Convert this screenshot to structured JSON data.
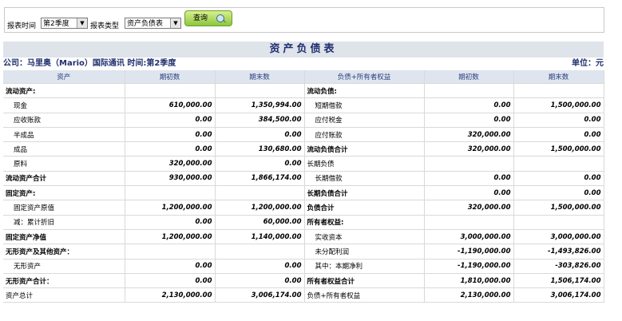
{
  "toolbar": {
    "period_label": "报表时间",
    "period_value": "第2季度",
    "type_label": "报表类型",
    "type_value": "资产负债表",
    "query_label": "查询"
  },
  "report": {
    "title": "资产负债表",
    "company_line": "公司：马里奥（Mario）国际通讯 时间:第2季度",
    "unit": "单位：元",
    "headers": [
      "资产",
      "期初数",
      "期末数",
      "负债+所有者权益",
      "期初数",
      "期末数"
    ],
    "rows": [
      [
        "流动资产:",
        "",
        "",
        "流动负债:",
        "",
        ""
      ],
      [
        "现金",
        "610,000.00",
        "1,350,994.00",
        "短期借款",
        "0.00",
        "1,500,000.00"
      ],
      [
        "应收账款",
        "0.00",
        "384,500.00",
        "应付税金",
        "0.00",
        "0.00"
      ],
      [
        "半成品",
        "0.00",
        "0.00",
        "应付账款",
        "320,000.00",
        "0.00"
      ],
      [
        "成品",
        "0.00",
        "130,680.00",
        "流动负债合计",
        "320,000.00",
        "1,500,000.00"
      ],
      [
        "原料",
        "320,000.00",
        "0.00",
        "长期负债",
        "",
        ""
      ],
      [
        "流动资产合计",
        "930,000.00",
        "1,866,174.00",
        "长期借款",
        "0.00",
        "0.00"
      ],
      [
        "固定资产:",
        "",
        "",
        "长期负债合计",
        "0.00",
        "0.00"
      ],
      [
        "固定资产原值",
        "1,200,000.00",
        "1,200,000.00",
        "负债合计",
        "320,000.00",
        "1,500,000.00"
      ],
      [
        "减：累计折旧",
        "0.00",
        "60,000.00",
        "所有者权益:",
        "",
        ""
      ],
      [
        "固定资产净值",
        "1,200,000.00",
        "1,140,000.00",
        "实收资本",
        "3,000,000.00",
        "3,000,000.00"
      ],
      [
        "无形资产及其他资产：",
        "",
        "",
        "未分配利润",
        "-1,190,000.00",
        "-1,493,826.00"
      ],
      [
        "无形资产",
        "0.00",
        "0.00",
        "其中：本期净利",
        "-1,190,000.00",
        "-303,826.00"
      ],
      [
        "无形资产合计：",
        "0.00",
        "0.00",
        "所有者权益合计",
        "1,810,000.00",
        "1,506,174.00"
      ],
      [
        "资产总计",
        "2,130,000.00",
        "3,006,174.00",
        "负债+所有者权益",
        "2,130,000.00",
        "3,006,174.00"
      ]
    ]
  }
}
